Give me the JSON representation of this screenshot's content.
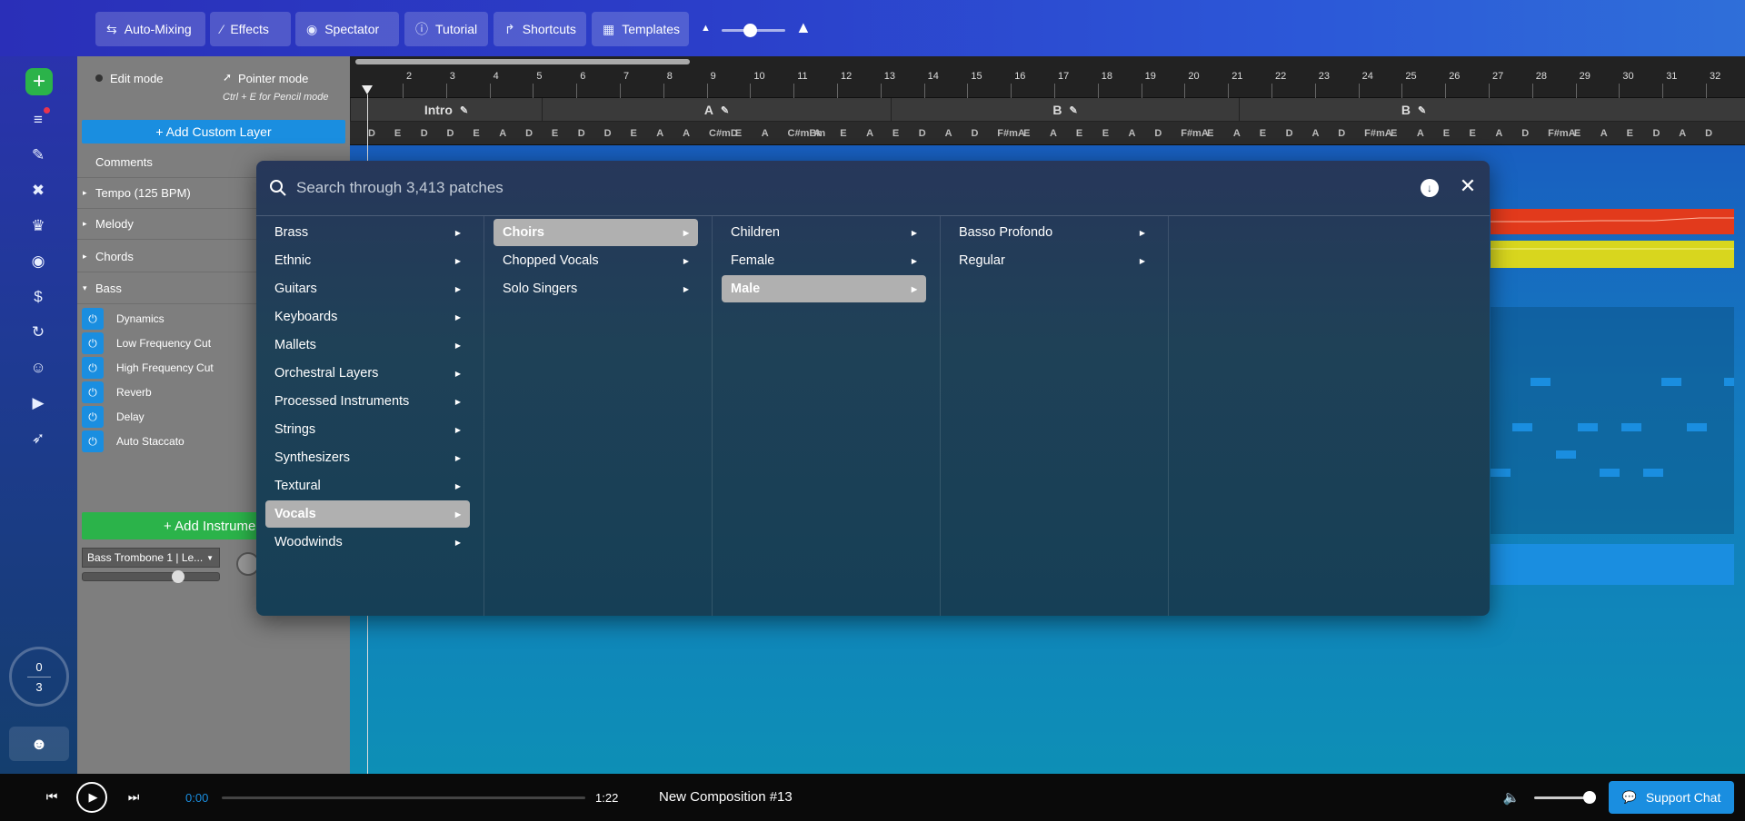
{
  "toolbar": {
    "buttons": [
      {
        "label": "Auto-Mixing",
        "icon": "sliders-icon"
      },
      {
        "label": "Effects",
        "icon": "wand-icon"
      },
      {
        "label": "Spectator",
        "icon": "eye-icon"
      },
      {
        "label": "Tutorial",
        "icon": "info-icon"
      },
      {
        "label": "Shortcuts",
        "icon": "shortcut-icon"
      },
      {
        "label": "Templates",
        "icon": "grid-icon"
      }
    ],
    "zoom_fraction": 0.45
  },
  "iconbar": {
    "counter_top": "0",
    "counter_bottom": "3"
  },
  "layers": {
    "edit_mode": "Edit mode",
    "pointer_mode": "Pointer mode",
    "pencil_hint": "Ctrl + E for Pencil mode",
    "add_custom_layer": "+ Add Custom Layer",
    "comments": "Comments",
    "groups": [
      "Tempo (125 BPM)",
      "Melody",
      "Chords",
      "Bass"
    ],
    "bass_effects": [
      "Dynamics",
      "Low Frequency Cut",
      "High Frequency Cut",
      "Reverb",
      "Delay",
      "Auto Staccato"
    ],
    "add_instrument": "+ Add Instrument",
    "instrument": "Bass Trombone 1 | Le...",
    "instrument_volume": 0.7
  },
  "timeline": {
    "bars": [
      "2",
      "3",
      "4",
      "5",
      "6",
      "7",
      "8",
      "9",
      "10",
      "11",
      "12",
      "13",
      "14",
      "15",
      "16",
      "17",
      "18",
      "19",
      "20",
      "21",
      "22",
      "23",
      "24",
      "25",
      "26",
      "27",
      "28",
      "29",
      "30",
      "31",
      "32"
    ],
    "sections": [
      {
        "label": "Intro"
      },
      {
        "label": "A"
      },
      {
        "label": "B"
      },
      {
        "label": "B"
      }
    ],
    "chords": [
      "D",
      "E",
      "D",
      "D",
      "E",
      "A",
      "D",
      "E",
      "D",
      "D",
      "E",
      "A",
      "A",
      "C#mD",
      "E",
      "A",
      "C#mBm",
      "A",
      "E",
      "A",
      "E",
      "D",
      "A",
      "D",
      "F#mA",
      "E",
      "A",
      "E",
      "E",
      "A",
      "D",
      "F#mA",
      "E",
      "A",
      "E",
      "D",
      "A",
      "D",
      "F#mA",
      "E",
      "A",
      "E",
      "E",
      "A",
      "D",
      "F#mA",
      "E",
      "A",
      "E",
      "D",
      "A",
      "D"
    ]
  },
  "patch_browser": {
    "search_placeholder": "Search through 3,413 patches",
    "categories": [
      "Brass",
      "Ethnic",
      "Guitars",
      "Keyboards",
      "Mallets",
      "Orchestral Layers",
      "Processed Instruments",
      "Strings",
      "Synthesizers",
      "Textural",
      "Vocals",
      "Woodwinds"
    ],
    "selected_category": "Vocals",
    "vocals_sub": [
      "Choirs",
      "Chopped Vocals",
      "Solo Singers"
    ],
    "selected_vocals_sub": "Choirs",
    "choirs_sub": [
      "Children",
      "Female",
      "Male"
    ],
    "selected_choirs_sub": "Male",
    "male_sub": [
      "Basso Profondo",
      "Regular"
    ]
  },
  "player": {
    "current_time": "0:00",
    "total_time": "1:22",
    "composition": "New Composition #13",
    "support_chat": "Support Chat"
  },
  "colors": {
    "accent_blue": "#1a8ee0",
    "green": "#2bb34a",
    "melody_track": "#e23a1c",
    "chords_track": "#d8d61e",
    "panel_gray": "#7e7e7e"
  }
}
